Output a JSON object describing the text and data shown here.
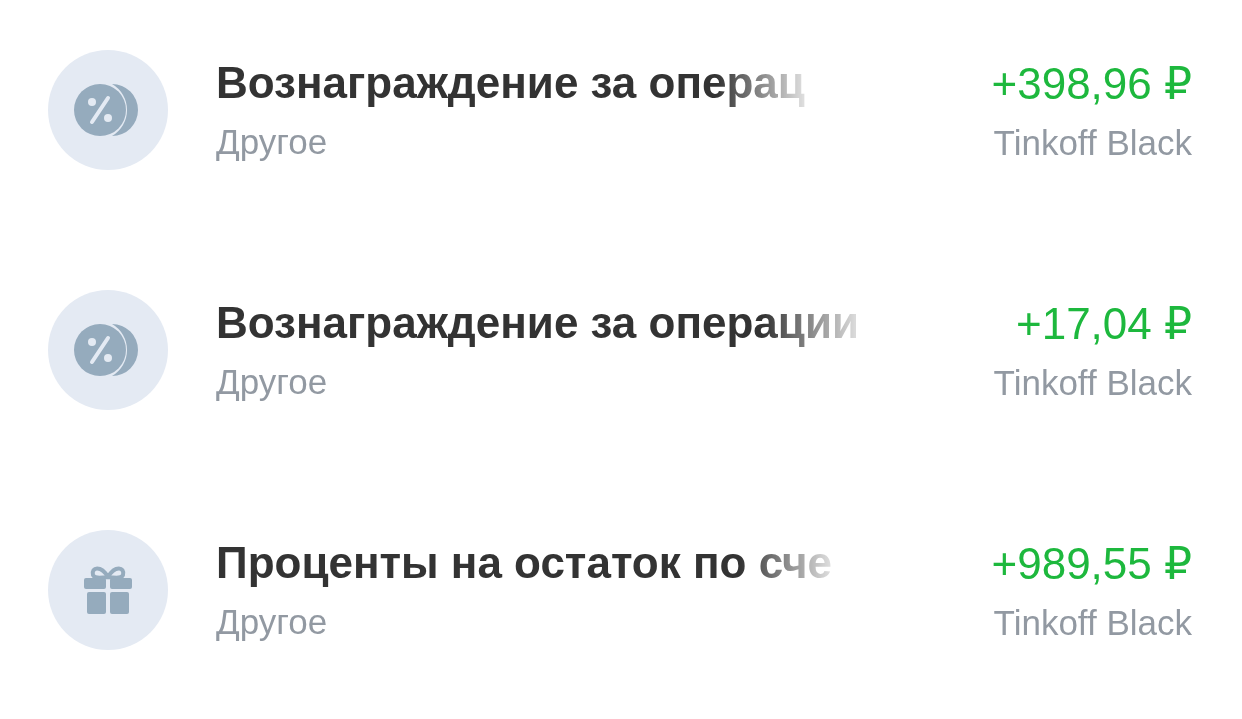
{
  "operations": [
    {
      "kind": "percent",
      "title": "Вознаграждение за операц",
      "category": "Другое",
      "amount": "+398,96 ₽",
      "account": "Tinkoff Black"
    },
    {
      "kind": "percent",
      "title": "Вознаграждение за операции",
      "category": "Другое",
      "amount": "+17,04 ₽",
      "account": "Tinkoff Black"
    },
    {
      "kind": "gift",
      "title": "Проценты на остаток по сче",
      "category": "Другое",
      "amount": "+989,55 ₽",
      "account": "Tinkoff Black"
    }
  ]
}
